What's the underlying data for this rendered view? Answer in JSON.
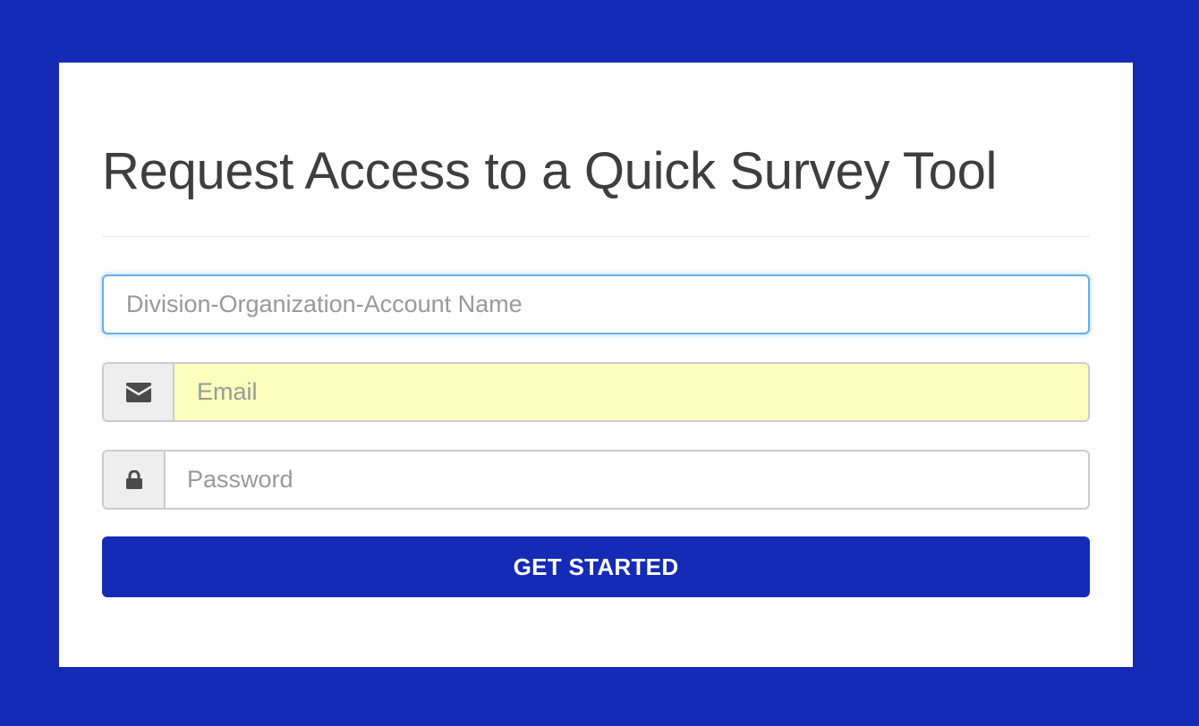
{
  "page": {
    "title": "Request Access to a Quick Survey Tool",
    "background_color": "#152bb6"
  },
  "form": {
    "account_name": {
      "placeholder": "Division-Organization-Account Name",
      "value": ""
    },
    "email": {
      "placeholder": "Email",
      "value": "",
      "icon": "envelope-icon",
      "autofill_color": "#faffbd"
    },
    "password": {
      "placeholder": "Password",
      "value": "",
      "icon": "lock-icon"
    },
    "submit_label": "GET STARTED",
    "submit_color": "#152bb6"
  }
}
